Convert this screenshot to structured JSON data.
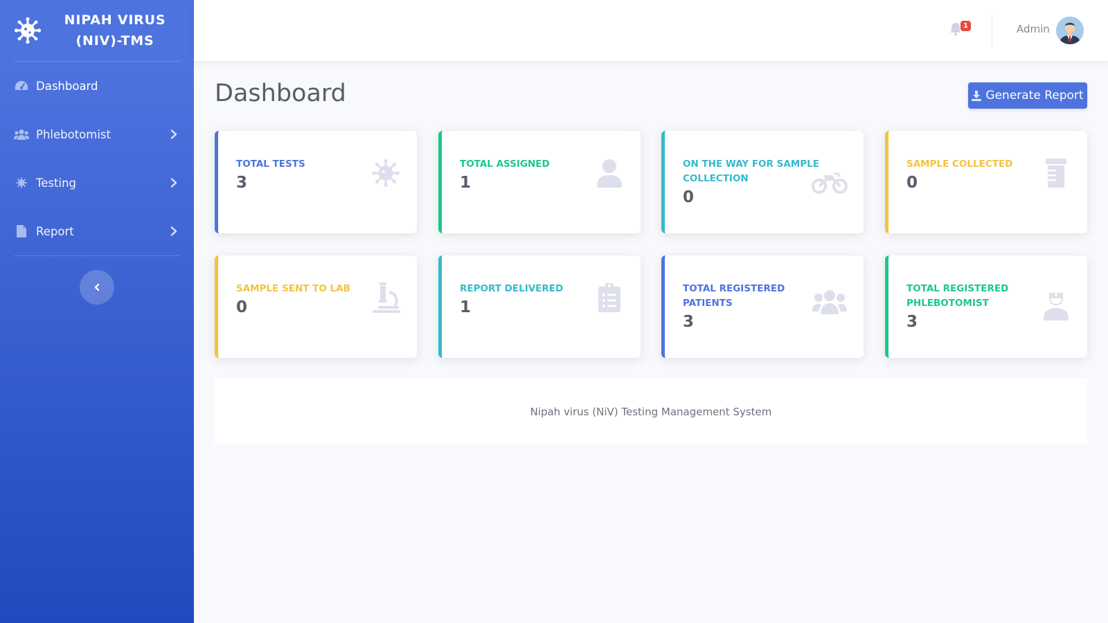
{
  "brand": {
    "title": "NIPAH VIRUS (NIV)-TMS",
    "icon": "virus-icon"
  },
  "sidebar": {
    "items": [
      {
        "label": "Dashboard",
        "icon": "tachometer-icon"
      },
      {
        "label": "Phlebotomist",
        "icon": "users-icon"
      },
      {
        "label": "Testing",
        "icon": "virus-icon"
      },
      {
        "label": "Report",
        "icon": "file-icon"
      }
    ]
  },
  "topbar": {
    "notification_count": "1",
    "user_name": "Admin"
  },
  "page": {
    "title": "Dashboard",
    "generate_report_label": "Generate Report"
  },
  "cards": [
    {
      "label": "TOTAL TESTS",
      "value": "3",
      "color": "#4e73df",
      "icon": "virus-icon"
    },
    {
      "label": "TOTAL ASSIGNED",
      "value": "1",
      "color": "#1cc88a",
      "icon": "user-icon"
    },
    {
      "label": "ON THE WAY FOR SAMPLE COLLECTION",
      "value": "0",
      "color": "#36b9cc",
      "icon": "motorcycle-icon"
    },
    {
      "label": "SAMPLE COLLECTED",
      "value": "0",
      "color": "#f6c23e",
      "icon": "prescription-bottle-icon"
    },
    {
      "label": "SAMPLE SENT TO LAB",
      "value": "0",
      "color": "#f6c23e",
      "icon": "microscope-icon"
    },
    {
      "label": "REPORT DELIVERED",
      "value": "1",
      "color": "#36b9cc",
      "icon": "clipboard-list-icon"
    },
    {
      "label": "TOTAL REGISTERED PATIENTS",
      "value": "3",
      "color": "#4e73df",
      "icon": "users-icon"
    },
    {
      "label": "TOTAL REGISTERED PHLEBOTOMIST",
      "value": "3",
      "color": "#1cc88a",
      "icon": "user-nurse-icon"
    }
  ],
  "footer": {
    "text": "Nipah virus (NiV) Testing Management System"
  }
}
